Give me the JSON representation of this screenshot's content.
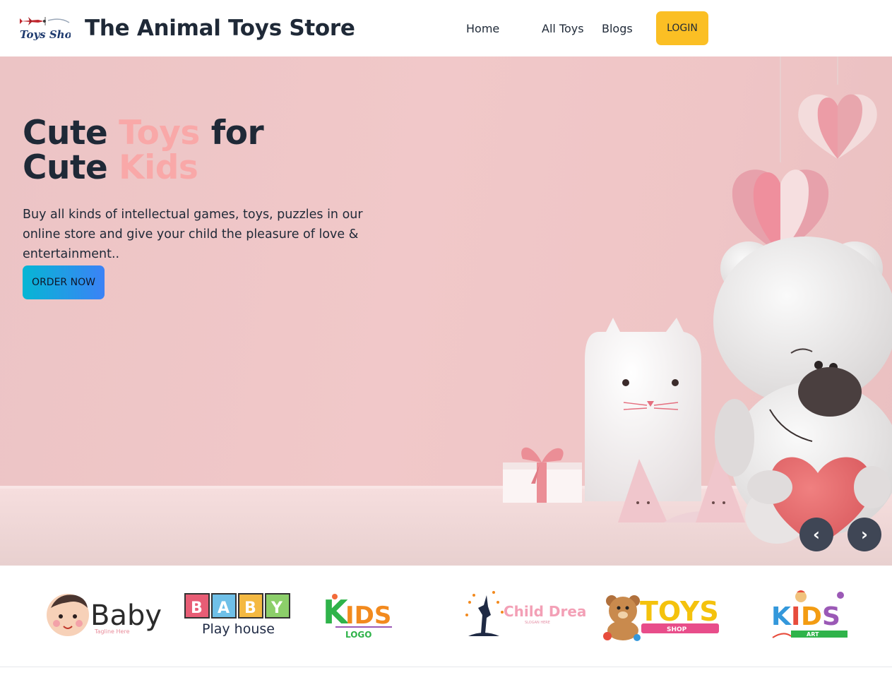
{
  "navbar": {
    "logo_text": "Toys Shop",
    "title": "The Animal Toys Store",
    "links": [
      "Home",
      "All Toys",
      "Blogs"
    ],
    "login_label": "LOGIN"
  },
  "hero": {
    "title_line1_a": "Cute ",
    "title_line1_accent": "Toys",
    "title_line1_b": " for",
    "title_line2_a": "Cute ",
    "title_line2_accent": "Kids",
    "description": "Buy all kinds of intellectual games, toys, puzzles in our online store and give your child the pleasure of love & entertainment..",
    "cta_label": "ORDER NOW",
    "prev_label": "‹",
    "next_label": "›"
  },
  "brands": [
    {
      "name": "Baby",
      "tagline": "Tagline Here"
    },
    {
      "name": "BABY",
      "subtitle": "Play house"
    },
    {
      "name": "KIDS",
      "subtitle": "LOGO"
    },
    {
      "name": "Child Dream",
      "subtitle": "SLOGAN HERE"
    },
    {
      "name": "TOYS",
      "subtitle": "SHOP"
    },
    {
      "name": "KIDS",
      "subtitle": "ART"
    }
  ],
  "colors": {
    "accent_yellow": "#fbbf24",
    "hero_pink": "#f1c8c9",
    "title_accent": "#f9a8a8",
    "cta_gradient_start": "#06b6d4",
    "cta_gradient_end": "#3b82f6",
    "carousel_btn": "#3f4655",
    "text_dark": "#1f2937"
  }
}
